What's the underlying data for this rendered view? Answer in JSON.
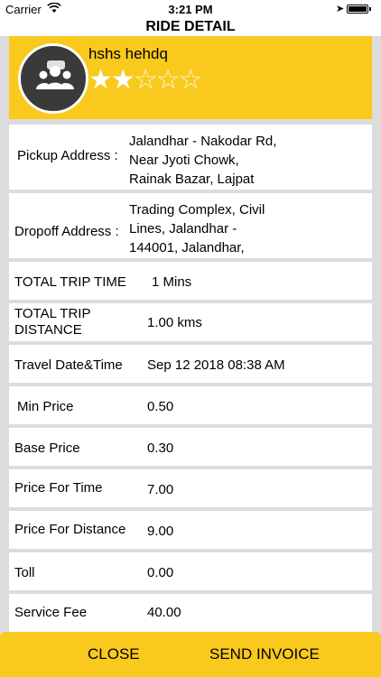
{
  "status_bar": {
    "carrier": "Carrier",
    "time": "3:21 PM"
  },
  "screen_title": "RIDE DETAIL",
  "driver": {
    "name": "hshs hehdq",
    "rating": 2,
    "rating_max": 5
  },
  "pickup": {
    "label": "Pickup Address :",
    "line1": "Jalandhar - Nakodar Rd,",
    "line2": "Near Jyoti Chowk,",
    "line3": "Rainak Bazar, Lajpat"
  },
  "dropoff": {
    "label": "Dropoff Address :",
    "line1": "Trading Complex, Civil",
    "line2": "Lines, Jalandhar -",
    "line3": "144001, Jalandhar,"
  },
  "details": {
    "trip_time_label": "TOTAL TRIP TIME",
    "trip_time_value": "1 Mins",
    "trip_distance_label_1": "TOTAL TRIP",
    "trip_distance_label_2": "DISTANCE",
    "trip_distance_value": "1.00 kms",
    "travel_date_label": "Travel Date&Time",
    "travel_date_value": "Sep 12 2018 08:38 AM",
    "min_price_label": "Min Price",
    "min_price_value": "0.50",
    "base_price_label": "Base Price",
    "base_price_value": "0.30",
    "price_time_label": "Price For Time",
    "price_time_value": "7.00",
    "price_distance_label": "Price For Distance",
    "price_distance_value": "9.00",
    "toll_label": "Toll",
    "toll_value": "0.00",
    "service_fee_label": "Service Fee",
    "service_fee_value": "40.00"
  },
  "actions": {
    "close_label": "CLOSE",
    "send_invoice_label": "SEND INVOICE"
  },
  "colors": {
    "accent": "#f9c91e",
    "background": "#dcdcdc",
    "avatar": "#3a3a3a"
  },
  "icons": {
    "avatar": "group-chat-icon",
    "wifi": "wifi-icon",
    "location": "location-arrow-icon",
    "battery": "battery-icon"
  }
}
